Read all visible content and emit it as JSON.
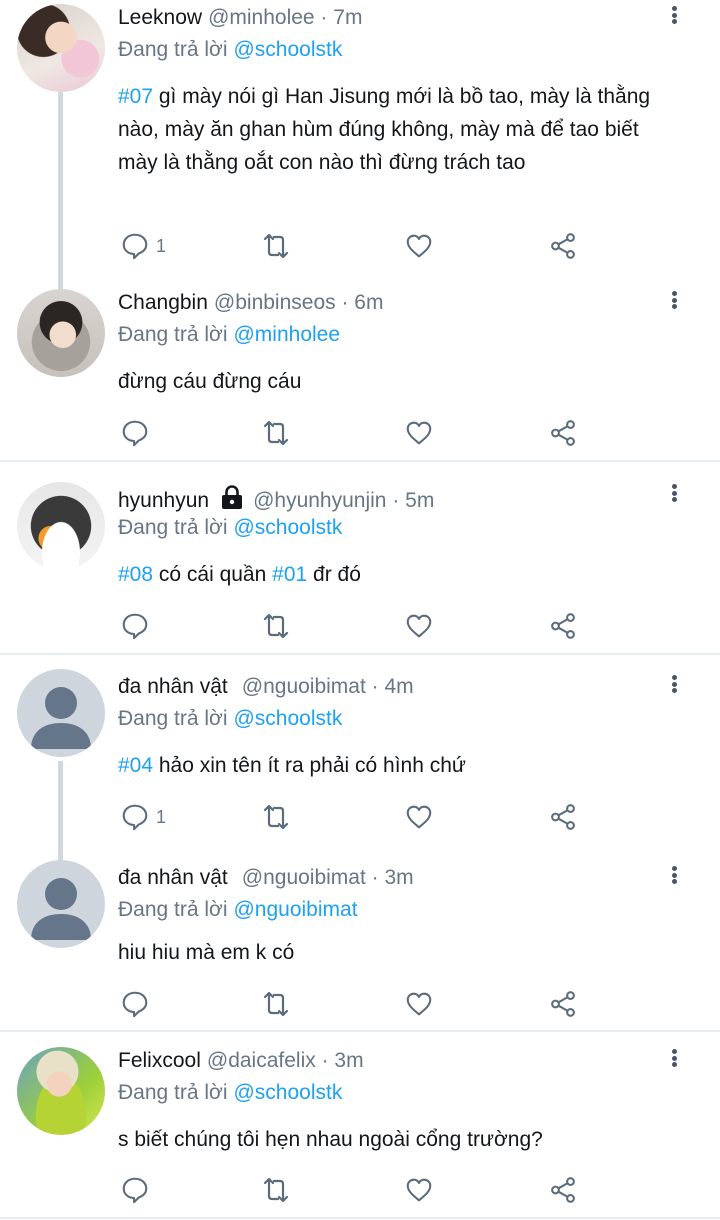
{
  "tweets": [
    {
      "name": "Leeknow",
      "handle": "@minholee · 7m",
      "reply_prefix": "Đang trả lời",
      "reply_to": "@schoolstk",
      "tag": "#07",
      "text": " gì mày nói gì Han Jisung mới là bồ tao,  mày là thằng nào,  mày ăn ghan hùm đúng không,  mày mà để tao biết mày là thằng oắt con nào thì đừng trách tao",
      "reply_count": "1"
    },
    {
      "name": "Changbin",
      "handle": "@binbinseos · 6m",
      "reply_prefix": "Đang trả lời",
      "reply_to": "@minholee",
      "text": "đừng cáu đừng cáu",
      "reply_count": ""
    },
    {
      "name": "hyunhyun",
      "handle": "@hyunhyunjin · 5m",
      "reply_prefix": "Đang trả lời",
      "reply_to": "@schoolstk",
      "tag": "#08",
      "text_mid": " có cái quần ",
      "tag2": "#01",
      "text_end": " đr đó",
      "reply_count": ""
    },
    {
      "name": "đa nhân vật",
      "handle": "@nguoibimat · 4m",
      "reply_prefix": "Đang trả lời",
      "reply_to": "@schoolstk",
      "tag": "#04",
      "text": " hảo xin tên ít ra phải có hình chứ",
      "reply_count": "1"
    },
    {
      "name": "đa nhân vật",
      "handle": "@nguoibimat · 3m",
      "reply_prefix": "Đang trả lời",
      "reply_to": "@nguoibimat",
      "text": "hiu hiu mà em k có",
      "reply_count": ""
    },
    {
      "name": "Felixcool",
      "handle": "@daicafelix · 3m",
      "reply_prefix": "Đang trả lời",
      "reply_to": "@schoolstk",
      "text": "s biết chúng tôi hẹn nhau ngoài cổng trường?",
      "reply_count": ""
    }
  ],
  "icons": {
    "reply": "reply-icon",
    "retweet": "retweet-icon",
    "like": "heart-icon",
    "share": "share-icon",
    "more": "more-vertical-icon",
    "lock": "lock-icon"
  },
  "colors": {
    "accent": "#1da1f2",
    "muted": "#687684",
    "icon": "#5b6b7a",
    "thread": "#cfd9de"
  }
}
